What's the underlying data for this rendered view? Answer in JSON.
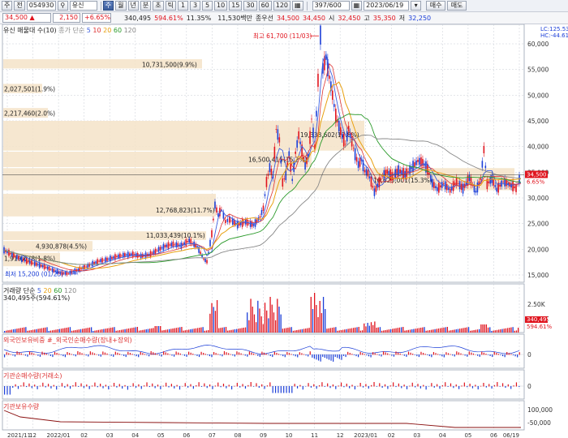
{
  "toolbar1": {
    "btn1": "주",
    "btn2": "전",
    "code": "054930",
    "search_icon": "search-icon",
    "name": "유신",
    "periods": [
      "주",
      "월",
      "년",
      "분",
      "초",
      "틱"
    ],
    "intervals": [
      "1",
      "3",
      "5",
      "10",
      "15",
      "30",
      "60",
      "120"
    ],
    "count": "397/600",
    "date": "2023/06/19",
    "buy": "매수",
    "sell": "매도"
  },
  "toolbar2": {
    "price": "34,500",
    "arrow": "▲",
    "change": "2,150",
    "change_pct": "+6.65%",
    "volume": "340,495",
    "vol_pct": "594.61%",
    "turnover_pct": "11.35%",
    "amount": "11,530백만",
    "open_label": "종우선",
    "open": "34,500",
    "high_price": "34,450",
    "low_label1": "시",
    "low1": "32,450",
    "high_label": "고",
    "high": "35,350",
    "low_label": "저",
    "low": "32,250"
  },
  "panels": {
    "price_label": "유신 매물대 수(10)",
    "ma_label_prefix": "종가 단순",
    "ma_periods": [
      "5",
      "10",
      "20",
      "60",
      "120"
    ],
    "lc_text": "LC:125.53",
    "hc_text": "HC:-44.61",
    "volume_label": "거래량 단순",
    "volume_ma": [
      "5",
      "20",
      "60",
      "120"
    ],
    "volume_value": "340,495주(594.61%)",
    "foreign_label": "외국인보유비중 #_외국인순매수량(장내+장외)",
    "inst_label": "기관순매수량(거래소)",
    "inst_hold_label": "기관보유수량"
  },
  "annotations": {
    "top": "최고 61,700 (11/03)",
    "bottom": "최저 15,200 (01/25)",
    "bands": [
      "10,731,500(9.9%)",
      "2,027,501(1.9%)",
      "2,217,460(2.0%)",
      "19,338,602(17.8%)",
      "16,500,415(15.2%)",
      "12,768,823(11.7%)",
      "11,033,439(10.1%)",
      "4,930,878(4.5%)",
      "1,910,678(1.8%)",
      "16,625,001(15.3%)"
    ]
  },
  "price_axis": [
    "60,000",
    "55,000",
    "50,000",
    "45,000",
    "40,000",
    "35,000",
    "30,000",
    "25,000",
    "20,000",
    "15,000"
  ],
  "current_price_tag": "34,500",
  "current_pct_tag": "6.65%",
  "volume_axis": [
    "2.50K",
    "2,000K"
  ],
  "volume_tag1": "340,495",
  "volume_tag2": "594.61%",
  "foreign_axis": [
    "0"
  ],
  "inst_axis": [
    "0"
  ],
  "hold_axis": [
    "100,000",
    "-50,000"
  ],
  "date_axis": [
    "2021/11",
    "12",
    "2022/01",
    "02",
    "03",
    "04",
    "05",
    "06",
    "07",
    "08",
    "09",
    "10",
    "11",
    "12",
    "2023/01",
    "02",
    "03",
    "04",
    "05",
    "06",
    "06/19"
  ],
  "colors": {
    "up": "#e0141e",
    "down": "#1c3fd8",
    "band": "#f5e3c8",
    "ma5": "#3b5ddf",
    "ma10": "#d33",
    "ma20": "#e8a010",
    "ma60": "#2a9a2a",
    "ma120": "#888888"
  }
}
